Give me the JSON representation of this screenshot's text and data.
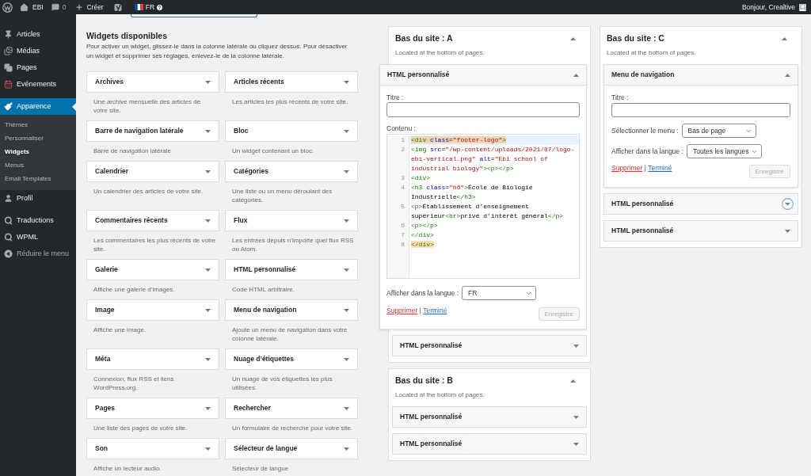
{
  "admin_bar": {
    "site": "EBI",
    "comments": "0",
    "new": "Créer",
    "language": "FR",
    "account": "Bonjour, Crealtive"
  },
  "sidebar": {
    "groups": [
      {
        "items": [
          {
            "label": "Articles",
            "selected": false
          },
          {
            "label": "Médias",
            "selected": false
          },
          {
            "label": "Pages",
            "selected": false
          },
          {
            "label": "Evénements",
            "selected": false
          }
        ]
      },
      {
        "items": [
          {
            "label": "Apparence",
            "selected": true,
            "children": [
              {
                "label": "Thèmes",
                "selected": false
              },
              {
                "label": "Personnaliser",
                "selected": false
              },
              {
                "label": "Widgets",
                "selected": true
              },
              {
                "label": "Menus",
                "selected": false
              },
              {
                "label": "Email Templates",
                "selected": false
              }
            ]
          },
          {
            "label": "Profil",
            "selected": false
          }
        ]
      },
      {
        "items": [
          {
            "label": "Traductions",
            "selected": false
          },
          {
            "label": "WPML",
            "selected": false
          }
        ]
      }
    ],
    "collapse": "Réduire le menu"
  },
  "available": {
    "heading": "Widgets disponibles",
    "intro": "Pour activer un widget, glissez-le dans la colonne latérale ou cliquez dessus. Pour désactiver un widget et supprimer ses réglages, enlevez-le de la colonne latérale.",
    "widgets": [
      {
        "title": "Archives",
        "description": "Une archive mensuelle des articles de votre site."
      },
      {
        "title": "Articles récents",
        "description": "Les articles les plus récents de votre site."
      },
      {
        "title": "Barre de navigation latérale",
        "description": "Barre de navigation latérale"
      },
      {
        "title": "Bloc",
        "description": "Un widget contenant un bloc."
      },
      {
        "title": "Calendrier",
        "description": "Un calendrier des articles de votre site."
      },
      {
        "title": "Catégories",
        "description": "Une liste ou un menu déroulant des catégories."
      },
      {
        "title": "Commentaires récents",
        "description": "Les commentaires les plus récents de votre site."
      },
      {
        "title": "Flux",
        "description": "Les entrées depuis n’importe quel flux RSS ou Atom."
      },
      {
        "title": "Galerie",
        "description": "Affiche une galerie d’images."
      },
      {
        "title": "HTML personnalisé",
        "description": "Code HTML arbitraire."
      },
      {
        "title": "Image",
        "description": "Affiche une image."
      },
      {
        "title": "Menu de navigation",
        "description": "Ajoute un menu de navigation dans votre colonne latérale."
      },
      {
        "title": "Méta",
        "description": "Connexion, flux RSS et liens WordPress.org."
      },
      {
        "title": "Nuage d’étiquettes",
        "description": "Un nuage de vos étiquettes les plus utilisées."
      },
      {
        "title": "Pages",
        "description": "Une liste des pages de votre site."
      },
      {
        "title": "Rechercher",
        "description": "Un formulaire de recherche pour votre site."
      },
      {
        "title": "Son",
        "description": "Affiche un lecteur audio."
      },
      {
        "title": "Sélecteur de langue",
        "description": "Sélecteur de langue"
      }
    ]
  },
  "area_columns": [
    {
      "areas": [
        {
          "title": "Bas du site : A",
          "description": "Located at the bottom of pages.",
          "expanded": true,
          "widgets": [
            {
              "kind": "custom_html",
              "title": "HTML personnalisé",
              "expanded": true,
              "focused": false,
              "form": {
                "fields": [
                  {
                    "kind": "text",
                    "label": "Titre :"
                  },
                  {
                    "kind": "code",
                    "label": "Contenu :",
                    "lines": [
                      {
                        "number": "1",
                        "active": true,
                        "matched": true,
                        "tokens": [
                          {
                            "kind": "tag",
                            "text": "<div"
                          },
                          {
                            "kind": "attribute",
                            "text": " class"
                          },
                          {
                            "kind": "plain",
                            "text": "="
                          },
                          {
                            "kind": "string",
                            "text": "\"footer-logo\""
                          },
                          {
                            "kind": "tag",
                            "text": ">"
                          }
                        ]
                      },
                      {
                        "number": "2",
                        "active": false,
                        "matched": false,
                        "tokens": [
                          {
                            "kind": "tag",
                            "text": "<img"
                          },
                          {
                            "kind": "attribute",
                            "text": " src"
                          },
                          {
                            "kind": "plain",
                            "text": "="
                          },
                          {
                            "kind": "string",
                            "text": "\"/wp-content/uploads/2021/07/logo-ebi-vertical.png\""
                          },
                          {
                            "kind": "attribute",
                            "text": " alt"
                          },
                          {
                            "kind": "plain",
                            "text": "="
                          },
                          {
                            "kind": "string",
                            "text": "\"Ebi school of industrial biology\""
                          },
                          {
                            "kind": "tag",
                            "text": "><p></p>"
                          }
                        ]
                      },
                      {
                        "number": "3",
                        "active": false,
                        "matched": false,
                        "tokens": [
                          {
                            "kind": "tag",
                            "text": "<div>"
                          }
                        ]
                      },
                      {
                        "number": "4",
                        "active": false,
                        "matched": false,
                        "tokens": [
                          {
                            "kind": "tag",
                            "text": "<h3"
                          },
                          {
                            "kind": "attribute",
                            "text": " class"
                          },
                          {
                            "kind": "plain",
                            "text": "="
                          },
                          {
                            "kind": "string",
                            "text": "\"h6\""
                          },
                          {
                            "kind": "tag",
                            "text": ">"
                          },
                          {
                            "kind": "plain",
                            "text": "École de Biologie Industrielle"
                          },
                          {
                            "kind": "tag",
                            "text": "</h3>"
                          }
                        ]
                      },
                      {
                        "number": "5",
                        "active": false,
                        "matched": false,
                        "tokens": [
                          {
                            "kind": "tag",
                            "text": "<p>"
                          },
                          {
                            "kind": "plain",
                            "text": "Établissement d’enseignement supérieur"
                          },
                          {
                            "kind": "tag",
                            "text": "<br>"
                          },
                          {
                            "kind": "plain",
                            "text": "privé d’intérêt général"
                          },
                          {
                            "kind": "tag",
                            "text": "</p>"
                          }
                        ]
                      },
                      {
                        "number": "6",
                        "active": false,
                        "matched": false,
                        "tokens": [
                          {
                            "kind": "tag",
                            "text": "<p></p>"
                          }
                        ]
                      },
                      {
                        "number": "7",
                        "active": false,
                        "matched": false,
                        "tokens": [
                          {
                            "kind": "tag",
                            "text": "</div>"
                          }
                        ]
                      },
                      {
                        "number": "8",
                        "active": false,
                        "matched": true,
                        "tokens": [
                          {
                            "kind": "tag",
                            "text": "</div>"
                          }
                        ]
                      }
                    ]
                  },
                  {
                    "kind": "select",
                    "label": "Afficher dans la langue :",
                    "value": "FR"
                  }
                ],
                "delete": "Supprimer",
                "done": "Terminé",
                "save": {
                  "label": "Enregistré",
                  "disabled": true
                }
              }
            },
            {
              "kind": "custom_html",
              "title": "HTML personnalisé",
              "expanded": false,
              "focused": false
            }
          ]
        },
        {
          "title": "Bas du site : B",
          "description": "Located at the bottom of pages.",
          "expanded": true,
          "widgets": [
            {
              "kind": "custom_html",
              "title": "HTML personnalisé",
              "expanded": false,
              "focused": false
            },
            {
              "kind": "custom_html",
              "title": "HTML personnalisé",
              "expanded": false,
              "focused": false
            }
          ]
        }
      ]
    },
    {
      "areas": [
        {
          "title": "Bas du site : C",
          "description": "Located at the bottom of pages.",
          "expanded": true,
          "widgets": [
            {
              "kind": "nav_menu",
              "title": "Menu de navigation",
              "expanded": true,
              "focused": false,
              "form": {
                "fields": [
                  {
                    "kind": "text",
                    "label": "Titre :"
                  },
                  {
                    "kind": "select",
                    "label": "Sélectionner le menu :",
                    "value": "Bas de page"
                  },
                  {
                    "kind": "select",
                    "label": "Afficher dans la langue :",
                    "value": "Toutes les langues"
                  }
                ],
                "delete": "Supprimer",
                "done": "Terminé",
                "save": {
                  "label": "Enregistré",
                  "disabled": true
                }
              }
            },
            {
              "kind": "custom_html",
              "title": "HTML personnalisé",
              "expanded": false,
              "focused": true
            },
            {
              "kind": "custom_html",
              "title": "HTML personnalisé",
              "expanded": false,
              "focused": false
            }
          ]
        }
      ]
    }
  ]
}
